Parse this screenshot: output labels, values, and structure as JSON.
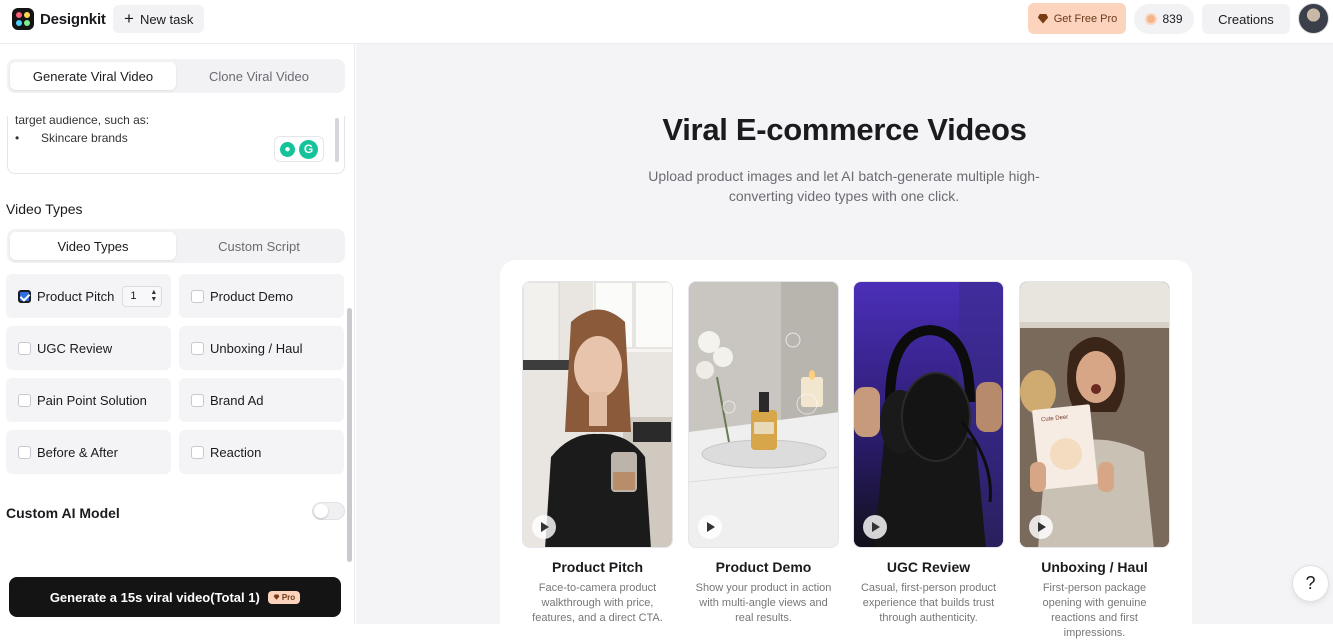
{
  "app": {
    "name": "Designkit"
  },
  "topbar": {
    "new_task": "New task",
    "get_pro": "Get Free Pro",
    "credits": "839",
    "creations": "Creations"
  },
  "sidebar": {
    "mode_tabs": [
      "Generate Viral Video",
      "Clone Viral Video"
    ],
    "prompt_lines": [
      "target audience, such as:",
      "•",
      "Skincare brands"
    ],
    "video_types_heading": "Video Types",
    "type_tabs": [
      "Video Types",
      "Custom Script"
    ],
    "types": [
      {
        "label": "Product Pitch",
        "checked": true,
        "count": "1"
      },
      {
        "label": "Product Demo",
        "checked": false
      },
      {
        "label": "UGC Review",
        "checked": false
      },
      {
        "label": "Unboxing / Haul",
        "checked": false
      },
      {
        "label": "Pain Point Solution",
        "checked": false
      },
      {
        "label": "Brand Ad",
        "checked": false
      },
      {
        "label": "Before & After",
        "checked": false
      },
      {
        "label": "Reaction",
        "checked": false
      }
    ],
    "custom_model_label": "Custom AI Model",
    "custom_model_enabled": false,
    "generate_button": "Generate a 15s viral video(Total 1)",
    "pro_badge": "Pro"
  },
  "main": {
    "title": "Viral E-commerce Videos",
    "subtitle": "Upload product images and let AI batch-generate multiple high-converting video types with one click.",
    "videos": [
      {
        "title": "Product Pitch",
        "desc": "Face-to-camera product walkthrough with price, features, and a direct CTA."
      },
      {
        "title": "Product Demo",
        "desc": "Show your product in action with multi-angle views and real results."
      },
      {
        "title": "UGC Review",
        "desc": "Casual, first-person product experience that builds trust through authenticity."
      },
      {
        "title": "Unboxing / Haul",
        "desc": "First-person package opening with genuine reactions and first impressions."
      }
    ]
  },
  "help": "?"
}
